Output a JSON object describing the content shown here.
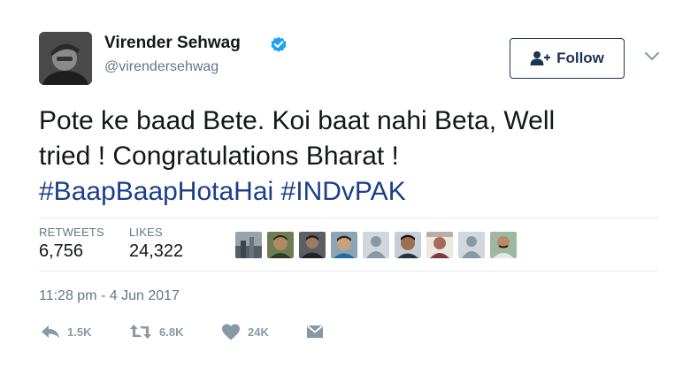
{
  "author": {
    "name": "Virender Sehwag",
    "handle": "@virendersehwag",
    "verified": true
  },
  "follow_label": "Follow",
  "tweet": {
    "line1": "Pote ke baad Bete. Koi baat nahi Beta, Well",
    "line2": "tried ! Congratulations Bharat !",
    "hashtags": [
      "#BaapBaapHotaHai",
      "#INDvPAK"
    ]
  },
  "stats": {
    "retweets_label": "RETWEETS",
    "retweets_value": "6,756",
    "likes_label": "LIKES",
    "likes_value": "24,322"
  },
  "likers_count": 9,
  "timestamp": "11:28 pm - 4 Jun 2017",
  "actions": {
    "reply_count": "1.5K",
    "retweet_count": "6.8K",
    "like_count": "24K"
  },
  "colors": {
    "hashtag": "#1b3f8b",
    "verified": "#1da1f2",
    "follow_border": "#1b3651",
    "muted": "#657786",
    "icon": "#8899a6"
  },
  "icons": [
    "verified-badge-icon",
    "add-user-icon",
    "chevron-down-icon",
    "reply-icon",
    "retweet-icon",
    "heart-icon",
    "message-icon"
  ]
}
